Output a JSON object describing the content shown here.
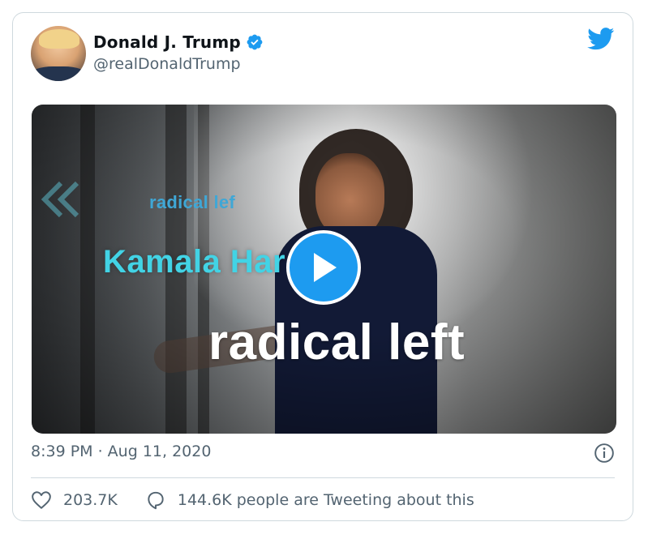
{
  "tweet": {
    "author_name": "Donald J. Trump",
    "handle": "@realDonaldTrump",
    "timestamp": "8:39 PM · Aug 11, 2020",
    "likes": "203.7K",
    "conversation": "144.6K people are Tweeting about this"
  },
  "media": {
    "caption_small": "radical lef",
    "caption_kamala": "Kamala Har",
    "caption_big": "radical left"
  },
  "icons": {
    "verified": "verified-badge-icon",
    "brand": "twitter-bird-icon",
    "play": "play-icon",
    "info": "info-icon",
    "like": "heart-icon",
    "reply": "speech-bubble-icon"
  },
  "colors": {
    "brand": "#1d9bf0",
    "secondary_text": "#536471",
    "border": "#cfd9de"
  }
}
